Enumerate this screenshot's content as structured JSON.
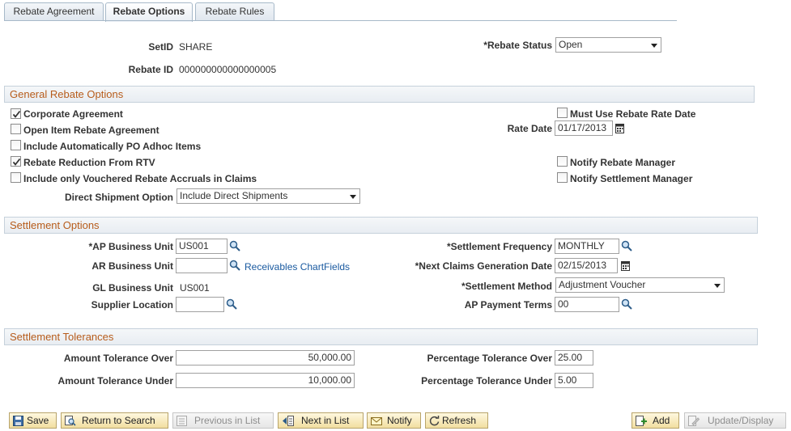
{
  "tabs": [
    {
      "label": "Rebate Agreement",
      "active": false
    },
    {
      "label": "Rebate Options",
      "active": true
    },
    {
      "label": "Rebate Rules",
      "active": false
    }
  ],
  "header": {
    "setid_label": "SetID",
    "setid_value": "SHARE",
    "rebate_id_label": "Rebate ID",
    "rebate_id_value": "000000000000000005",
    "status_label": "*Rebate Status",
    "status_value": "Open"
  },
  "general": {
    "title": "General Rebate Options",
    "corporate_agreement": {
      "label": "Corporate Agreement",
      "checked": true
    },
    "open_item": {
      "label": "Open Item Rebate Agreement",
      "checked": false
    },
    "include_po_adhoc": {
      "label": "Include Automatically PO Adhoc Items",
      "checked": false
    },
    "reduction_rtv": {
      "label": "Rebate Reduction From RTV",
      "checked": true
    },
    "vouchered_accruals": {
      "label": "Include only Vouchered Rebate Accruals in Claims",
      "checked": false
    },
    "must_use_rate_date": {
      "label": "Must Use Rebate Rate Date",
      "checked": false
    },
    "rate_date_label": "Rate Date",
    "rate_date_value": "01/17/2013",
    "notify_rebate_mgr": {
      "label": "Notify Rebate Manager",
      "checked": false
    },
    "notify_settlement_mgr": {
      "label": "Notify Settlement Manager",
      "checked": false
    },
    "direct_shipment_label": "Direct Shipment Option",
    "direct_shipment_value": "Include Direct Shipments"
  },
  "settlement": {
    "title": "Settlement Options",
    "ap_bu_label": "*AP Business Unit",
    "ap_bu_value": "US001",
    "ar_bu_label": "AR Business Unit",
    "ar_bu_value": "",
    "receivables_link": "Receivables ChartFields",
    "gl_bu_label": "GL Business Unit",
    "gl_bu_value": "US001",
    "supplier_loc_label": "Supplier Location",
    "supplier_loc_value": "",
    "freq_label": "*Settlement Frequency",
    "freq_value": "MONTHLY",
    "next_claims_label": "*Next Claims Generation Date",
    "next_claims_value": "02/15/2013",
    "method_label": "*Settlement Method",
    "method_value": "Adjustment Voucher",
    "ap_terms_label": "AP Payment Terms",
    "ap_terms_value": "00"
  },
  "tolerances": {
    "title": "Settlement Tolerances",
    "amt_over_label": "Amount Tolerance Over",
    "amt_over_value": "50,000.00",
    "amt_under_label": "Amount Tolerance Under",
    "amt_under_value": "10,000.00",
    "pct_over_label": "Percentage Tolerance Over",
    "pct_over_value": "25.00",
    "pct_under_label": "Percentage Tolerance Under",
    "pct_under_value": "5.00"
  },
  "toolbar": {
    "save": "Save",
    "return_to_search": "Return to Search",
    "previous_in_list": "Previous in List",
    "next_in_list": "Next in List",
    "notify": "Notify",
    "refresh": "Refresh",
    "add": "Add",
    "update_display": "Update/Display"
  },
  "colors": {
    "section_title": "#b75c1b",
    "link": "#1a5aa0",
    "button_bg": "#f1dea0"
  }
}
